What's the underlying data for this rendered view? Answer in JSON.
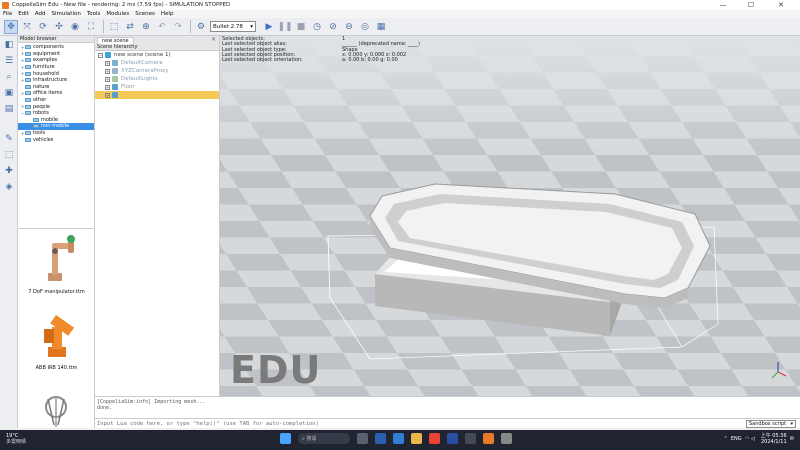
{
  "window": {
    "title": "CoppeliaSim Edu - New file - rendering: 2 ms (7.59 fps) - SIMULATION STOPPED",
    "minimize": "—",
    "maximize": "☐",
    "close": "✕"
  },
  "menu": [
    "File",
    "Edit",
    "Add",
    "Simulation",
    "Tools",
    "Modules",
    "Scenes",
    "Help"
  ],
  "toolbar": {
    "engine": "Bullet 2.78",
    "icons": [
      "select-icon",
      "translate-icon",
      "rotate-icon",
      "move-icon",
      "camera-icon",
      "fit-icon",
      "object-icon",
      "undo-icon",
      "redo-icon",
      "settings-icon",
      "play-icon",
      "pause-icon",
      "stop-icon",
      "realtime-icon",
      "speed-icon",
      "visualize-icon",
      "layers-icon"
    ]
  },
  "model_browser": {
    "header": "Model browser",
    "items": [
      {
        "label": "components",
        "indent": 0,
        "expander": "+"
      },
      {
        "label": "equipment",
        "indent": 0,
        "expander": "+"
      },
      {
        "label": "examples",
        "indent": 0,
        "expander": "+"
      },
      {
        "label": "furniture",
        "indent": 0,
        "expander": "+"
      },
      {
        "label": "household",
        "indent": 0,
        "expander": "+"
      },
      {
        "label": "infrastructure",
        "indent": 0,
        "expander": "+"
      },
      {
        "label": "nature",
        "indent": 0,
        "expander": ""
      },
      {
        "label": "office items",
        "indent": 0,
        "expander": "+"
      },
      {
        "label": "other",
        "indent": 0,
        "expander": ""
      },
      {
        "label": "people",
        "indent": 0,
        "expander": "+"
      },
      {
        "label": "robots",
        "indent": 0,
        "expander": "−"
      },
      {
        "label": "mobile",
        "indent": 1,
        "expander": ""
      },
      {
        "label": "non-mobile",
        "indent": 1,
        "expander": "",
        "selected": true
      },
      {
        "label": "tools",
        "indent": 0,
        "expander": "+"
      },
      {
        "label": "vehicles",
        "indent": 0,
        "expander": ""
      }
    ],
    "thumbnails": [
      "7 DoF manipulator.ttm",
      "ABB IRB 140.ttm"
    ]
  },
  "scene_hierarchy": {
    "tab": "new scene",
    "header": "Scene hierarchy",
    "items": [
      {
        "label": "new scene (scene 1)",
        "indent": 0,
        "icon_color": "#3aa6d8",
        "style": "root"
      },
      {
        "label": "DefaultCamera",
        "indent": 1,
        "icon_color": "#7ab0d0",
        "style": "dim"
      },
      {
        "label": "XYZCameraProxy",
        "indent": 1,
        "icon_color": "#9ab4c8",
        "style": "dim"
      },
      {
        "label": "DefaultLights",
        "indent": 1,
        "icon_color": "#a8c8a0",
        "style": "dim"
      },
      {
        "label": "Floor",
        "indent": 1,
        "icon_color": "#5aa0c8",
        "style": "dim"
      },
      {
        "label": "",
        "indent": 1,
        "icon_color": "#5a9ec8",
        "style": "selected"
      }
    ]
  },
  "info": {
    "rows": [
      {
        "k": "Selected objects:",
        "v": "1"
      },
      {
        "k": "Last selected object alias:",
        "v": "______ (deprecated name: ____)"
      },
      {
        "k": "Last selected object type:",
        "v": "Shape"
      },
      {
        "k": "Last selected object position:",
        "v": "x: 0.000   y: 0.000   z: 0.002"
      },
      {
        "k": "Last selected object orientation:",
        "v": "a: 0.00   b: 0.00   g: 0.00"
      }
    ]
  },
  "watermark": "EDU",
  "console": {
    "lines": [
      "[CoppeliaSim:info]  Importing mesh...",
      "done."
    ],
    "placeholder": "Input Lua code here, or type \"help()\" (use TAB for auto-completion)",
    "script_select": "Sandbox script"
  },
  "taskbar": {
    "temp": "19°C",
    "weather": "多雲時晴",
    "search_placeholder": "搜尋",
    "lang": "ENG",
    "time": "上午 05:36",
    "date": "2024/1/11"
  },
  "colors": {
    "accent": "#3a8ee6",
    "highlight": "#f5c95a",
    "floor_light": "#d9dcdf",
    "floor_dark": "#bfc3c8"
  }
}
